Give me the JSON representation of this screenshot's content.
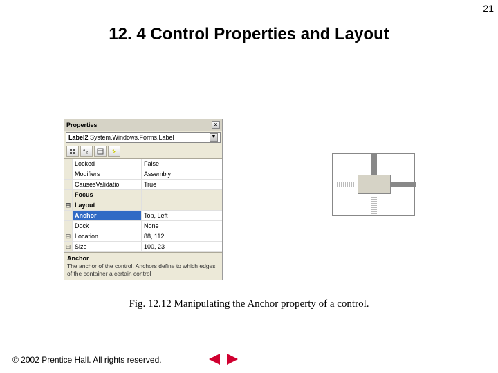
{
  "page_number": "21",
  "heading": "12. 4   Control Properties and Layout",
  "properties_panel": {
    "title": "Properties",
    "object_selector_bold": "Label2",
    "object_selector_rest": "  System.Windows.Forms.Label",
    "rows": [
      {
        "exp": "",
        "name": "Locked",
        "val": "False",
        "cat": false,
        "sel": false
      },
      {
        "exp": "",
        "name": "Modifiers",
        "val": "Assembly",
        "cat": false,
        "sel": false
      },
      {
        "exp": "",
        "name": "CausesValidatio",
        "val": "True",
        "cat": false,
        "sel": false
      },
      {
        "exp": "",
        "name": "Focus",
        "val": "",
        "cat": true,
        "sel": false
      },
      {
        "exp": "⊟",
        "name": "Layout",
        "val": "",
        "cat": true,
        "sel": false
      },
      {
        "exp": "",
        "name": "Anchor",
        "val": "Top, Left",
        "cat": false,
        "sel": true
      },
      {
        "exp": "",
        "name": "Dock",
        "val": "None",
        "cat": false,
        "sel": false
      },
      {
        "exp": "⊞",
        "name": "Location",
        "val": "88, 112",
        "cat": false,
        "sel": false
      },
      {
        "exp": "⊞",
        "name": "Size",
        "val": "100, 23",
        "cat": false,
        "sel": false
      }
    ],
    "desc_name": "Anchor",
    "desc_text": "The anchor of the control. Anchors define to which edges of the container a certain control"
  },
  "caption": "Fig. 12.12  Manipulating the Anchor property of a control.",
  "copyright": "© 2002 Prentice Hall.  All rights reserved."
}
